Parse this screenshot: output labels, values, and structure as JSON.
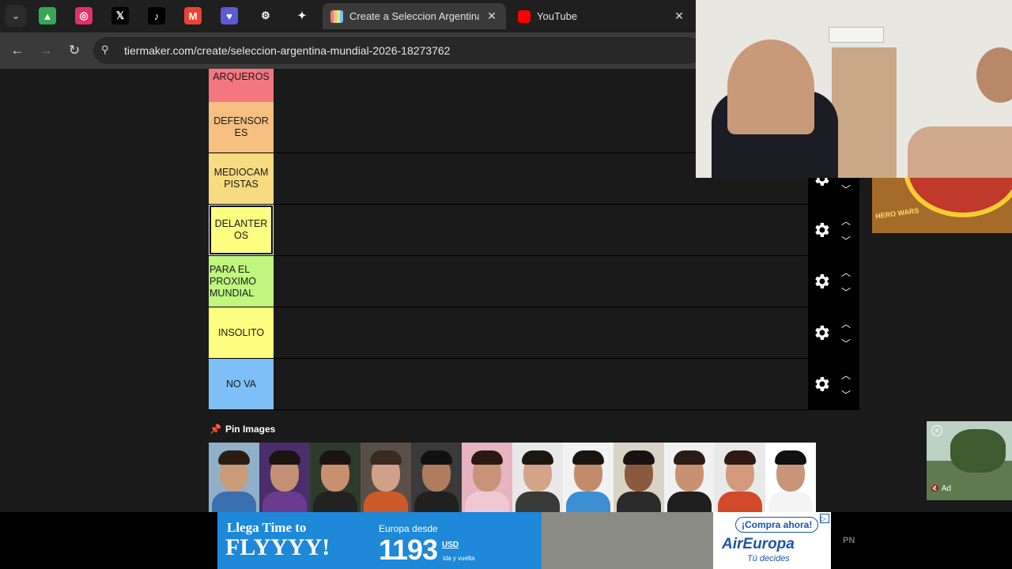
{
  "browser": {
    "pinned_tabs": [
      {
        "icon": "google-drive-icon",
        "color": "#34a853",
        "glyph": "▲"
      },
      {
        "icon": "instagram-icon",
        "color": "#e1306c",
        "glyph": "◎"
      },
      {
        "icon": "x-icon",
        "color": "#000000",
        "glyph": "𝕏"
      },
      {
        "icon": "tiktok-icon",
        "color": "#000000",
        "glyph": "♪"
      },
      {
        "icon": "gmail-icon",
        "color": "#ea4335",
        "glyph": "M"
      },
      {
        "icon": "shield-heart-icon",
        "color": "#5b5bd6",
        "glyph": "♥"
      },
      {
        "icon": "chatgpt-icon",
        "color": "#1f1f1f",
        "glyph": "⚙"
      },
      {
        "icon": "gemini-icon",
        "color": "#1f1f1f",
        "glyph": "✦"
      }
    ],
    "active_tab_title": "Create a Seleccion Argentina M",
    "other_tab_title": "YouTube",
    "url": "tiermaker.com/create/seleccion-argentina-mundial-2026-18273762"
  },
  "tiers": [
    {
      "label": "ARQUEROS",
      "color": "#f4777f"
    },
    {
      "label": "DEFENSOR ES",
      "color": "#f7bf80"
    },
    {
      "label": "MEDIOCAM PISTAS",
      "color": "#f7db80"
    },
    {
      "label": "DELANTER OS",
      "color": "#fdfd7f"
    },
    {
      "label": "PARA EL PROXIMO MUNDIAL",
      "color": "#bff780"
    },
    {
      "label": "INSOLITO",
      "color": "#fdfd7f"
    },
    {
      "label": "NO VA",
      "color": "#7fbff7"
    }
  ],
  "pin_images_label": "Pin Images",
  "player_images": [
    {
      "bg": "#8fb0c8",
      "skin": "#c99b7a",
      "hair": "#2b1d14",
      "shirt": "#3a6fb0"
    },
    {
      "bg": "#4a2d6a",
      "skin": "#c49073",
      "hair": "#1c1410",
      "shirt": "#6b3b8f"
    },
    {
      "bg": "#2e3a2a",
      "skin": "#c99070",
      "hair": "#1a1410",
      "shirt": "#222222"
    },
    {
      "bg": "#5a4f46",
      "skin": "#d1a088",
      "hair": "#3b2a1f",
      "shirt": "#cc5a2a"
    },
    {
      "bg": "#3a3a3a",
      "skin": "#b07c5e",
      "hair": "#111111",
      "shirt": "#202020"
    },
    {
      "bg": "#e8b3c1",
      "skin": "#c89378",
      "hair": "#2a1a12",
      "shirt": "#f0c8d4"
    },
    {
      "bg": "#e8e8e8",
      "skin": "#d3a488",
      "hair": "#1d1712",
      "shirt": "#3a3a3a"
    },
    {
      "bg": "#f2f2f2",
      "skin": "#c28c6c",
      "hair": "#1a1410",
      "shirt": "#3d8fd4"
    },
    {
      "bg": "#d9d3c6",
      "skin": "#8a5a3e",
      "hair": "#1a1210",
      "shirt": "#2a2a2a"
    },
    {
      "bg": "#f0f0f0",
      "skin": "#c89272",
      "hair": "#2a1c14",
      "shirt": "#1e1e1e"
    },
    {
      "bg": "#e9e9e9",
      "skin": "#d39a7e",
      "hair": "#2c1c14",
      "shirt": "#d34a2a"
    },
    {
      "bg": "#ffffff",
      "skin": "#c9957a",
      "hair": "#111111",
      "shirt": "#f4f4f4"
    }
  ],
  "ad_banner": {
    "headline_small": "Llega Time to",
    "headline_big": "FLYYYY!",
    "destination": "Europa desde",
    "price": "1193",
    "currency": "USD",
    "price_note": "ida y vuelta",
    "cta": "¡Compra ahora!",
    "brand": "AirEuropa",
    "tagline": "Tú decides",
    "badge": "PN"
  },
  "hero_ad": {
    "logo_text": "HERO WARS"
  },
  "video_ad": {
    "label": "Ad"
  },
  "colors": {
    "page_bg": "#1a1a1a",
    "control_bg": "#000000"
  }
}
